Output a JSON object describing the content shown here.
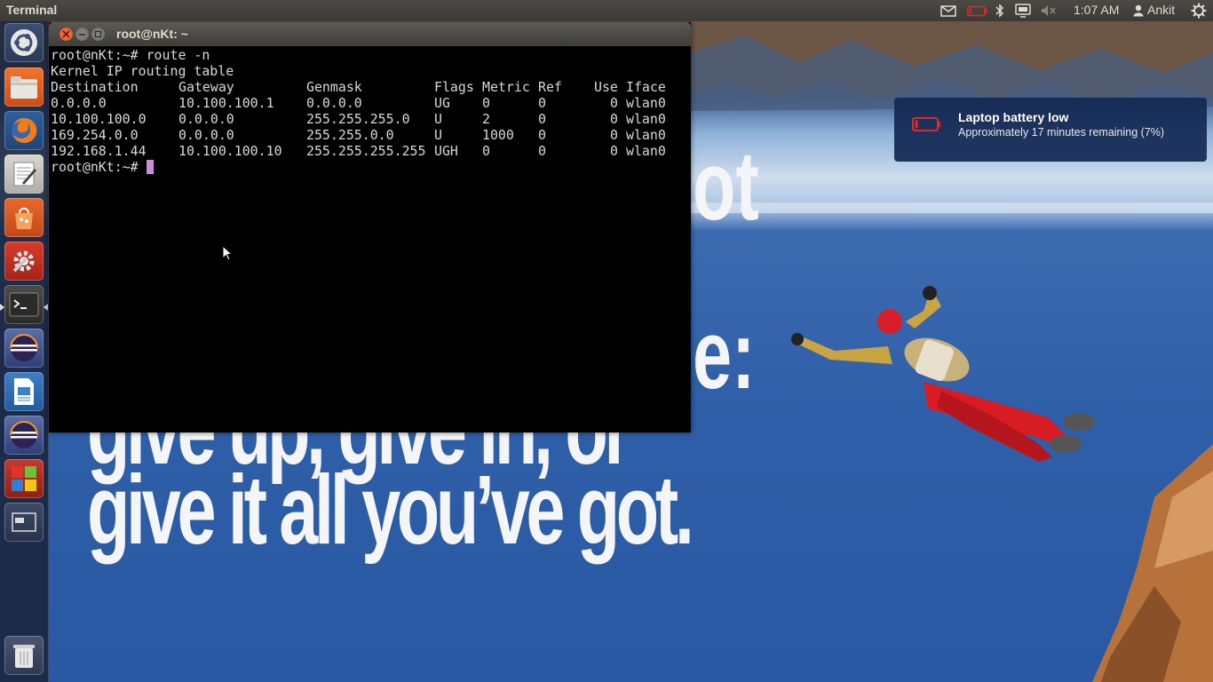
{
  "top_panel": {
    "app_name": "Terminal",
    "indicators": [
      "mail-icon",
      "battery-low-icon",
      "bluetooth-icon",
      "display-icon",
      "volume-muted-icon"
    ],
    "clock": "1:07 AM",
    "user_name": "Ankit",
    "session_icon": "gear-icon"
  },
  "launcher": {
    "items": [
      {
        "name": "dash-home",
        "icon": "ubuntu-logo-icon",
        "running": false
      },
      {
        "name": "files",
        "icon": "folder-icon",
        "running": false
      },
      {
        "name": "firefox",
        "icon": "firefox-icon",
        "running": false
      },
      {
        "name": "text-editor",
        "icon": "text-editor-icon",
        "running": false
      },
      {
        "name": "software-center",
        "icon": "shopping-bag-icon",
        "running": false
      },
      {
        "name": "system-settings",
        "icon": "settings-icon",
        "running": false
      },
      {
        "name": "terminal",
        "icon": "terminal-icon",
        "running": true,
        "active": true
      },
      {
        "name": "eclipse",
        "icon": "eclipse-icon",
        "running": false
      },
      {
        "name": "libreoffice-writer",
        "icon": "writer-icon",
        "running": false
      },
      {
        "name": "eclipse-2",
        "icon": "eclipse-icon",
        "running": false
      },
      {
        "name": "multicolor-app",
        "icon": "windows-logo-icon",
        "running": false
      },
      {
        "name": "workspace-switcher",
        "icon": "workspace-icon",
        "running": false
      },
      {
        "name": "trash",
        "icon": "trash-icon",
        "running": false
      }
    ]
  },
  "terminal": {
    "window_title": "root@nKt: ~",
    "prompt": "root@nKt:~# ",
    "command": "route -n",
    "table_title": "Kernel IP routing table",
    "headers": [
      "Destination",
      "Gateway",
      "Genmask",
      "Flags",
      "Metric",
      "Ref",
      "Use",
      "Iface"
    ],
    "rows": [
      [
        "0.0.0.0",
        "10.100.100.1",
        "0.0.0.0",
        "UG",
        "0",
        "0",
        "0",
        "wlan0"
      ],
      [
        "10.100.100.0",
        "0.0.0.0",
        "255.255.255.0",
        "U",
        "2",
        "0",
        "0",
        "wlan0"
      ],
      [
        "169.254.0.0",
        "0.0.0.0",
        "255.255.0.0",
        "U",
        "1000",
        "0",
        "0",
        "wlan0"
      ],
      [
        "192.168.1.44",
        "10.100.100.10",
        "255.255.255.255",
        "UGH",
        "0",
        "0",
        "0",
        "wlan0"
      ]
    ],
    "final_prompt": "root@nKt:~# ",
    "colors": {
      "background": "#000000",
      "foreground": "#dcd7d9",
      "cursor": "#c98fd2"
    }
  },
  "notification": {
    "icon": "battery-low-icon",
    "title": "Laptop battery low",
    "body": "Approximately 17 minutes remaining (7%)"
  },
  "wallpaper": {
    "quote_lines": [
      "give up, give in, or",
      "give it all you’ve got."
    ],
    "quote_fragments": [
      "ot",
      "e:"
    ]
  }
}
